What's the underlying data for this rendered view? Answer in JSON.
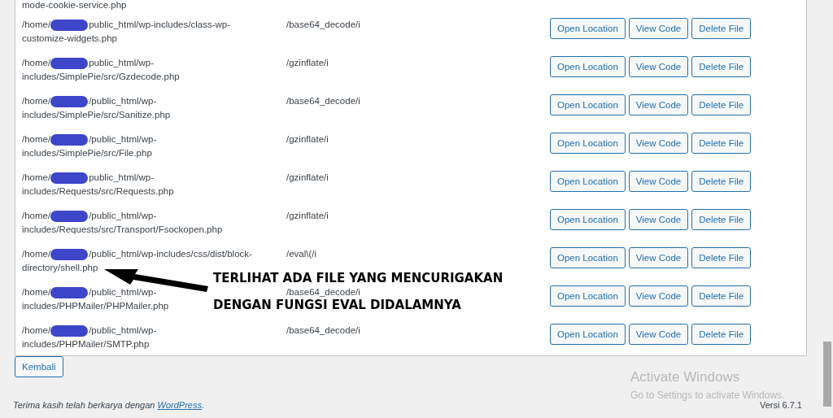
{
  "partial_row": {
    "path": "mode-cookie-service.php"
  },
  "rows": [
    {
      "path_prefix": "/home/",
      "path_line1": "public_html/wp-includes/class-wp-",
      "path_line2": "customize-widgets.php",
      "pattern": "/base64_decode/i",
      "buttons": [
        "Open Location",
        "View Code",
        "Delete File"
      ]
    },
    {
      "path_prefix": "/home/",
      "path_line1": "public_html/wp-",
      "path_line2": "includes/SimplePie/src/Gzdecode.php",
      "pattern": "/gzinflate/i",
      "buttons": [
        "Open Location",
        "View Code",
        "Delete File"
      ]
    },
    {
      "path_prefix": "/home/",
      "path_line1": "/public_html/wp-",
      "path_line2": "includes/SimplePie/src/Sanitize.php",
      "pattern": "/base64_decode/i",
      "buttons": [
        "Open Location",
        "View Code",
        "Delete File"
      ]
    },
    {
      "path_prefix": "/home/",
      "path_line1": "/public_html/wp-",
      "path_line2": "includes/SimplePie/src/File.php",
      "pattern": "/gzinflate/i",
      "buttons": [
        "Open Location",
        "View Code",
        "Delete File"
      ]
    },
    {
      "path_prefix": "/home/",
      "path_line1": "public_html/wp-",
      "path_line2": "includes/Requests/src/Requests.php",
      "pattern": "/gzinflate/i",
      "buttons": [
        "Open Location",
        "View Code",
        "Delete File"
      ]
    },
    {
      "path_prefix": "/home/",
      "path_line1": "/public_html/wp-",
      "path_line2": "includes/Requests/src/Transport/Fsockopen.php",
      "pattern": "/gzinflate/i",
      "buttons": [
        "Open Location",
        "View Code",
        "Delete File"
      ]
    },
    {
      "path_prefix": "/home/",
      "path_line1": "/public_html/wp-includes/css/dist/block-",
      "path_line2": "directory/shell.php",
      "pattern": "/eval\\(/i",
      "buttons": [
        "Open Location",
        "View Code",
        "Delete File"
      ]
    },
    {
      "path_prefix": "/home/",
      "path_line1": "/public_html/wp-",
      "path_line2": "includes/PHPMailer/PHPMailer.php",
      "pattern": "/base64_decode/i",
      "buttons": [
        "Open Location",
        "View Code",
        "Delete File"
      ]
    },
    {
      "path_prefix": "/home/",
      "path_line1": "/public_html/wp-",
      "path_line2": "includes/PHPMailer/SMTP.php",
      "pattern": "/base64_decode/i",
      "buttons": [
        "Open Location",
        "View Code",
        "Delete File"
      ]
    }
  ],
  "back_button": "Kembali",
  "annotation": {
    "lines": [
      "TERLIHAT ADA FILE YANG MENCURIGAKAN",
      "DENGAN FUNGSI EVAL DIDALAMNYA"
    ]
  },
  "os_notice": {
    "title": "Activate Windows",
    "text": "Go to Settings to activate Windows."
  },
  "footer": {
    "text": "Terima kasih telah berkarya dengan ",
    "link": "WordPress",
    "after": ".",
    "version": "Versi 6.7.1"
  }
}
